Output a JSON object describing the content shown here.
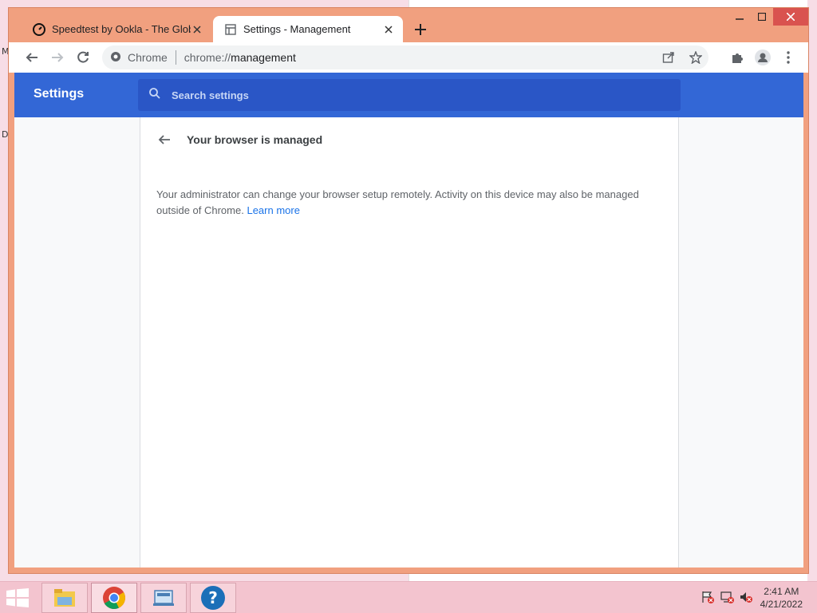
{
  "browser": {
    "tabs": [
      {
        "title": "Speedtest by Ookla - The Global",
        "icon": "speedtest-icon",
        "active": false
      },
      {
        "title": "Settings - Management",
        "icon": "settings-page-icon",
        "active": true
      }
    ],
    "omnibox": {
      "site_label": "Chrome",
      "url_scheme": "chrome://",
      "url_host": "management"
    }
  },
  "settings": {
    "title": "Settings",
    "search_placeholder": "Search settings",
    "page_title": "Your browser is managed",
    "body_text": "Your administrator can change your browser setup remotely. Activity on this device may also be managed outside of Chrome.",
    "learn_more": "Learn more"
  },
  "taskbar": {
    "apps": [
      "file-explorer-icon",
      "chrome-icon",
      "network-window-icon",
      "help-icon"
    ],
    "clock_time": "2:41 AM",
    "clock_date": "4/21/2022"
  },
  "colors": {
    "window_frame": "#f1a07f",
    "settings_header": "#3367d6",
    "link": "#1a73e8",
    "taskbar": "#f3c4cf"
  }
}
